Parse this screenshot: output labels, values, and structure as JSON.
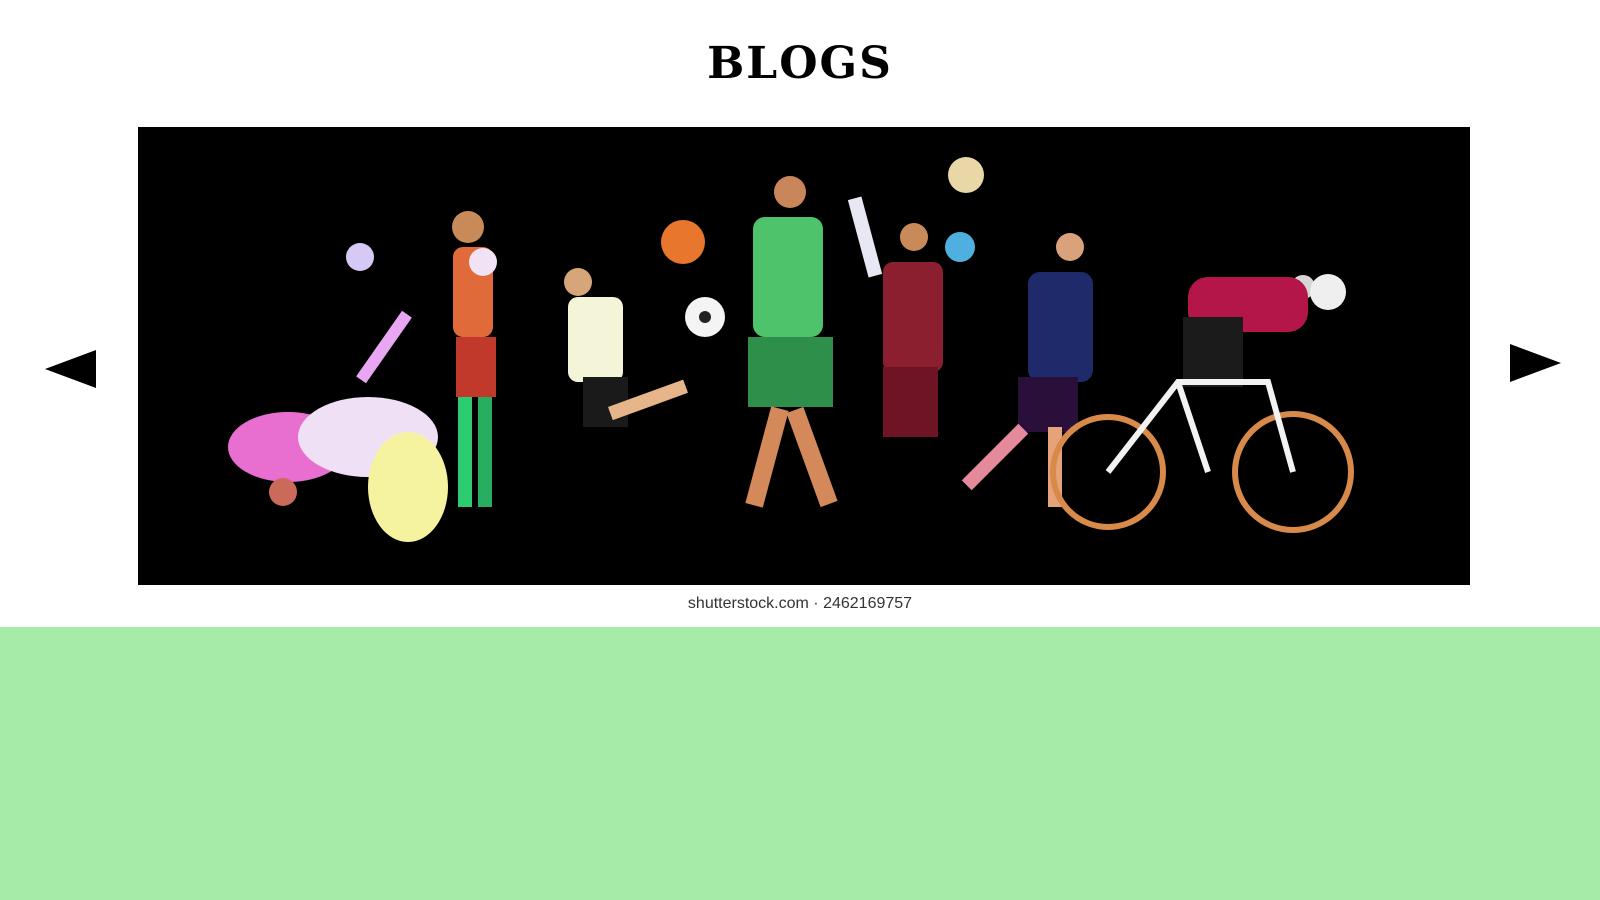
{
  "header": {
    "title": "BLOGS"
  },
  "carousel": {
    "image_caption": "shutterstock.com · 2462169757",
    "prev_icon": "triangle-left",
    "next_icon": "triangle-right"
  },
  "colors": {
    "background": "#ffffff",
    "band": "#a6eba8",
    "image_background": "#000000",
    "arrow": "#000000"
  }
}
